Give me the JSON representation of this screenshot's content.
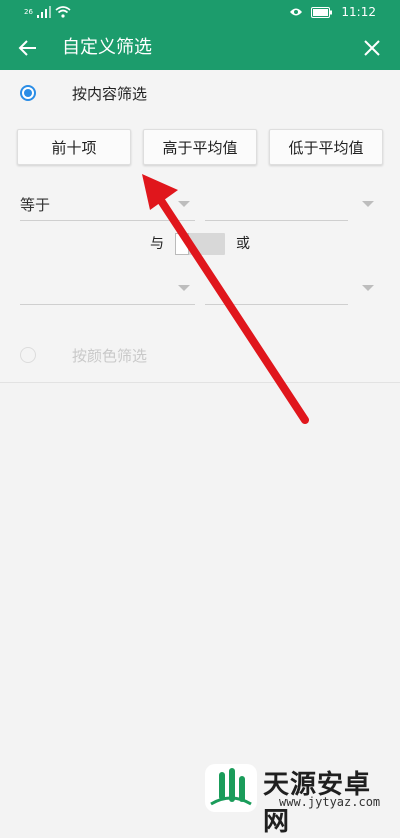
{
  "status_bar": {
    "network": "26",
    "time": "11:12"
  },
  "app_bar": {
    "title": "自定义筛选",
    "back_icon": "arrow-left-icon",
    "close_icon": "close-icon"
  },
  "filter_by_content": {
    "label": "按内容筛选",
    "selected": true
  },
  "quick_buttons": [
    "前十项",
    "高于平均值",
    "低于平均值"
  ],
  "condition1": {
    "operator": "等于",
    "value": ""
  },
  "logic": {
    "and_label": "与",
    "or_label": "或"
  },
  "condition2": {
    "operator": "",
    "value": ""
  },
  "filter_by_color": {
    "label": "按颜色筛选",
    "selected": false
  },
  "watermark": {
    "name": "天源安卓网",
    "url": "www.jytyaz.com"
  },
  "colors": {
    "header": "#1c9c6c",
    "radio_accent": "#2a8de6",
    "annotation_arrow": "#e0161c"
  }
}
